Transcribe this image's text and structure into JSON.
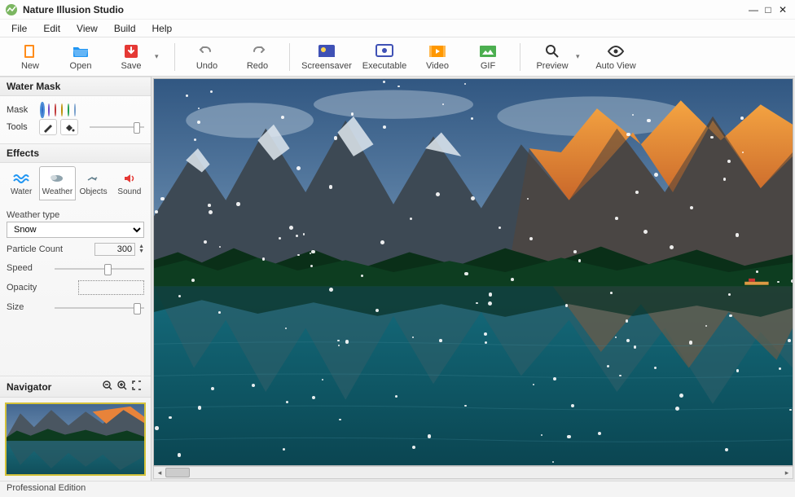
{
  "app": {
    "title": "Nature Illusion Studio"
  },
  "window_controls": {
    "min": "—",
    "max": "□",
    "close": "✕"
  },
  "menu": [
    "File",
    "Edit",
    "View",
    "Build",
    "Help"
  ],
  "toolbar": [
    {
      "id": "new",
      "label": "New"
    },
    {
      "id": "open",
      "label": "Open"
    },
    {
      "id": "save",
      "label": "Save",
      "caret": true
    },
    {
      "sep": true
    },
    {
      "id": "undo",
      "label": "Undo"
    },
    {
      "id": "redo",
      "label": "Redo"
    },
    {
      "sep": true
    },
    {
      "id": "screensaver",
      "label": "Screensaver"
    },
    {
      "id": "executable",
      "label": "Executable"
    },
    {
      "id": "video",
      "label": "Video"
    },
    {
      "id": "gif",
      "label": "GIF"
    },
    {
      "sep": true
    },
    {
      "id": "preview",
      "label": "Preview",
      "caret": true
    },
    {
      "id": "autoview",
      "label": "Auto View"
    }
  ],
  "panels": {
    "watermask": {
      "title": "Water Mask",
      "mask_label": "Mask",
      "tools_label": "Tools",
      "colors": [
        "#3b82f6",
        "#8b5cf6",
        "#ef4444",
        "#eab308",
        "#22c55e",
        "#93c5fd"
      ],
      "selected_color_index": 0
    },
    "effects": {
      "title": "Effects",
      "tabs": [
        {
          "id": "water",
          "label": "Water"
        },
        {
          "id": "weather",
          "label": "Weather"
        },
        {
          "id": "objects",
          "label": "Objects"
        },
        {
          "id": "sound",
          "label": "Sound"
        }
      ],
      "active_tab": 1,
      "weather": {
        "type_label": "Weather type",
        "type_value": "Snow",
        "particle_label": "Particle Count",
        "particle_value": "300",
        "speed_label": "Speed",
        "opacity_label": "Opacity",
        "size_label": "Size"
      }
    },
    "navigator": {
      "title": "Navigator"
    }
  },
  "status": {
    "edition": "Professional Edition"
  }
}
